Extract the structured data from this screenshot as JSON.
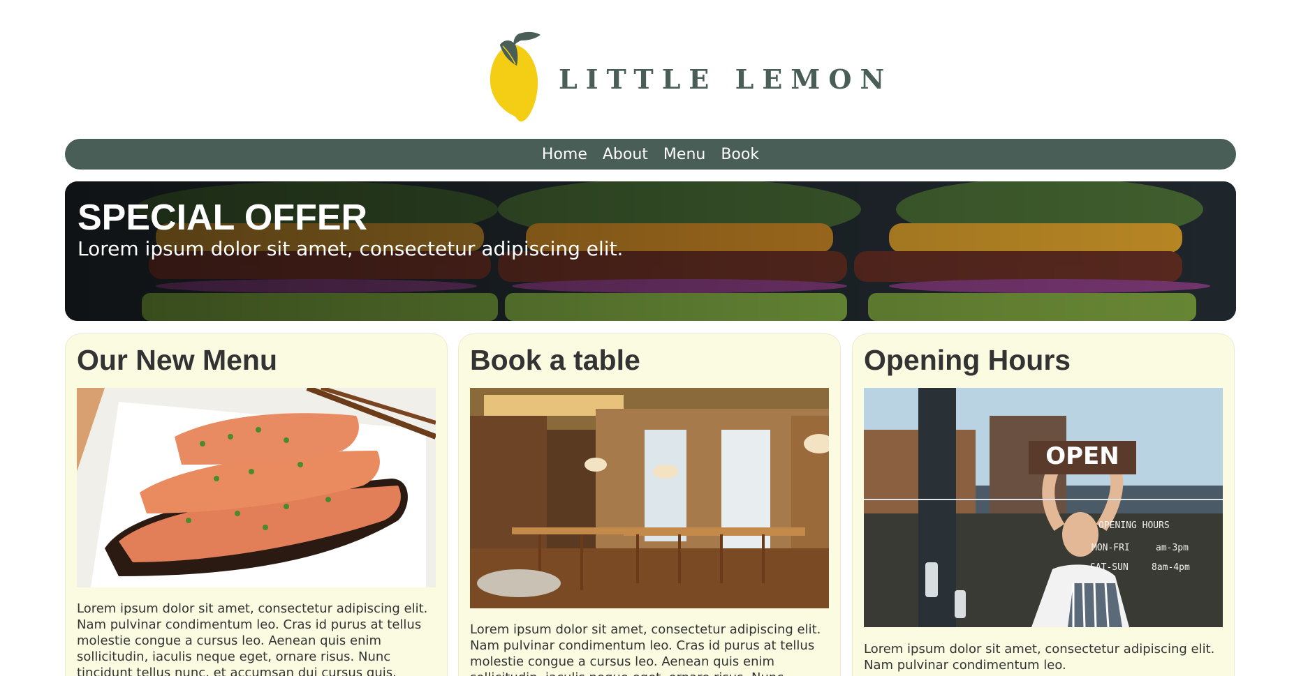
{
  "brand": {
    "name": "LITTLE LEMON",
    "logo_icon": "lemon-icon",
    "colors": {
      "primary": "#495e57",
      "accent": "#f4ce14",
      "card_background": "#fbfbe2"
    }
  },
  "nav": {
    "items": [
      {
        "label": "Home"
      },
      {
        "label": "About"
      },
      {
        "label": "Menu"
      },
      {
        "label": "Book"
      }
    ]
  },
  "hero": {
    "title": "SPECIAL OFFER",
    "subtitle": "Lorem ipsum dolor sit amet, consectetur adipiscing elit."
  },
  "cards": [
    {
      "title": "Our New Menu",
      "image": "salmon-dish-photo",
      "text": "Lorem ipsum dolor sit amet, consectetur adipiscing elit. Nam pulvinar condimentum leo. Cras id purus at tellus molestie congue a cursus leo. Aenean quis enim sollicitudin, iaculis neque eget, ornare risus. Nunc tincidunt tellus nunc, et accumsan dui cursus quis."
    },
    {
      "title": "Book a table",
      "image": "restaurant-interior-photo",
      "text": "Lorem ipsum dolor sit amet, consectetur adipiscing elit. Nam pulvinar condimentum leo. Cras id purus at tellus molestie congue a cursus leo. Aenean quis enim sollicitudin, iaculis neque eget, ornare risus. Nunc"
    },
    {
      "title": "Opening Hours",
      "image": "open-sign-photo",
      "sign": {
        "open": "OPEN",
        "heading": "OPENING HOURS",
        "weekday": "MON-FRI",
        "weekday_hours": "am-3pm",
        "weekend": "SAT-SUN",
        "weekend_hours": "8am-4pm"
      },
      "text": "Lorem ipsum dolor sit amet, consectetur adipiscing elit. Nam pulvinar condimentum leo."
    }
  ]
}
